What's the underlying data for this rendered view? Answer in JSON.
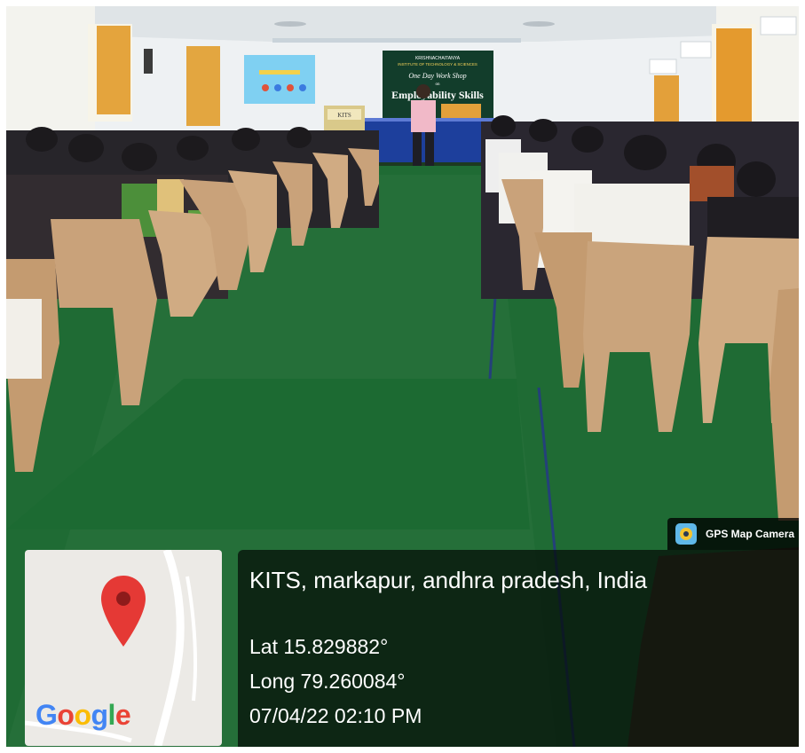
{
  "photo": {
    "description_banner": {
      "line1": "KRISHNACHAITANYA",
      "line2": "INSTITUTE OF TECHNOLOGY & SCIENCES",
      "line3": "One Day Work Shop",
      "line4": "on",
      "line5": "Employability Skills"
    },
    "podium_label": "KITS",
    "colors": {
      "carpet": "#1f6b34",
      "stage_skirt": "#1d3f9c",
      "chair": "#c9a27a",
      "wall": "#e9edf0",
      "curtain": "#e0a23a",
      "banner": "#123d2b"
    }
  },
  "gps_overlay": {
    "app_name": "GPS Map Camera",
    "address": "KITS, markapur, andhra pradesh, India",
    "latitude": "Lat 15.829882°",
    "longitude": "Long 79.260084°",
    "datetime": "07/04/22 02:10 PM",
    "map": {
      "logo_letters": [
        "G",
        "o",
        "o",
        "g",
        "l",
        "e"
      ],
      "pin_color": "#e53935"
    }
  }
}
